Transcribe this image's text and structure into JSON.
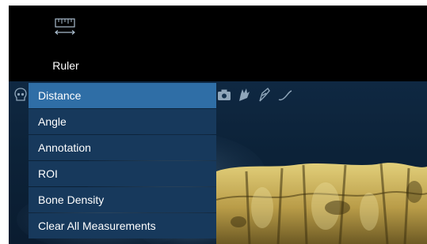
{
  "toolbar": {
    "ruler": {
      "label": "Ruler",
      "icon": "ruler-icon"
    }
  },
  "view_toolbar": {
    "icons": [
      "skull-icon",
      "camera-icon",
      "hand-icon",
      "pen-icon",
      "curve-icon"
    ]
  },
  "menu": {
    "items": [
      {
        "label": "Distance",
        "selected": true
      },
      {
        "label": "Angle",
        "selected": false
      },
      {
        "label": "Annotation",
        "selected": false
      },
      {
        "label": "ROI",
        "selected": false
      },
      {
        "label": "Bone Density",
        "selected": false
      },
      {
        "label": "Clear All Measurements",
        "selected": false
      }
    ]
  },
  "colors": {
    "menu_background": "#17395c",
    "menu_selected": "#2f6ea6",
    "viewport_background": "#0c2238",
    "bone": "#c9b25a"
  }
}
